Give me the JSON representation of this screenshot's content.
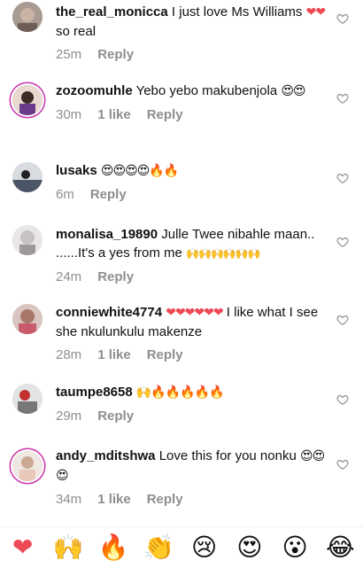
{
  "comments": [
    {
      "username": "the_real_monicca",
      "text": "I just love Ms Williams",
      "emoji_suffix": "❤❤",
      "text_after": "so real",
      "time": "25m",
      "likes": "",
      "reply": "Reply"
    },
    {
      "username": "zozoomuhle",
      "text": "Yebo yebo makubenjola",
      "emoji_suffix": "😍😍",
      "text_after": "",
      "time": "30m",
      "likes": "1 like",
      "reply": "Reply"
    },
    {
      "username": "lusaks",
      "text": "",
      "emoji_suffix": "😍😍😍😍🔥🔥",
      "text_after": "",
      "time": "6m",
      "likes": "",
      "reply": "Reply"
    },
    {
      "username": "monalisa_19890",
      "text": "Julle Twee nibahle maan.. ......It's a yes from me",
      "emoji_suffix": "🙌🙌🙌🙌🙌🙌",
      "text_after": "",
      "time": "24m",
      "likes": "",
      "reply": "Reply"
    },
    {
      "username": "conniewhite4774",
      "text": "",
      "emoji_suffix": "❤❤❤❤❤❤",
      "text_after": "I like what I see she nkulunkulu makenze",
      "time": "28m",
      "likes": "1 like",
      "reply": "Reply"
    },
    {
      "username": "taumpe8658",
      "text": "",
      "emoji_suffix": "🙌🔥🔥🔥🔥🔥",
      "text_after": "",
      "time": "29m",
      "likes": "",
      "reply": "Reply"
    },
    {
      "username": "andy_mditshwa",
      "text": "Love this for you nonku",
      "emoji_suffix": "😍😍😍",
      "text_after": "",
      "time": "34m",
      "likes": "1 like",
      "reply": "Reply"
    }
  ],
  "reactions": [
    "❤",
    "🙌",
    "🔥",
    "👏",
    "😢",
    "😍",
    "😮",
    "😂"
  ],
  "icons": {
    "like": "heart-outline-icon"
  },
  "colors": {
    "meta": "#8e8e8e",
    "story_ring": "#c837ab",
    "heart_red": "#ed4956"
  }
}
